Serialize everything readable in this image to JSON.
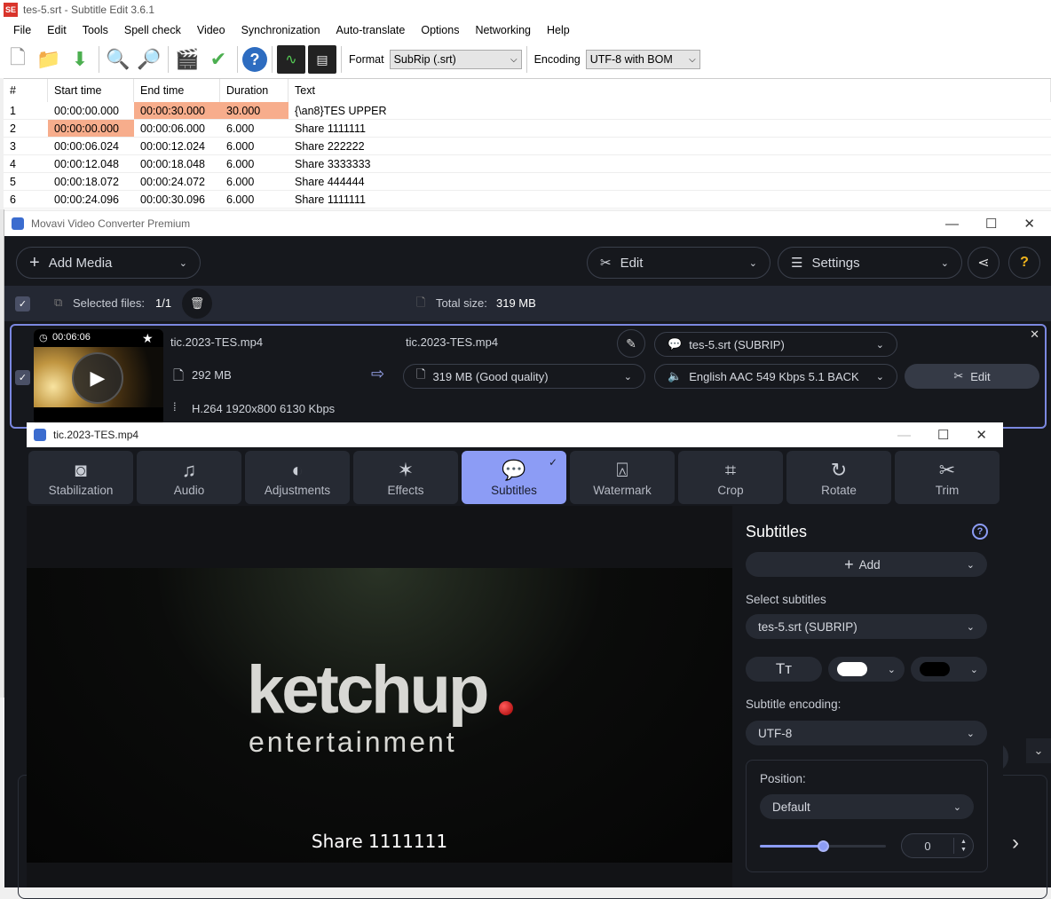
{
  "se": {
    "title": "tes-5.srt - Subtitle Edit 3.6.1",
    "logo": "SE",
    "menu": [
      "File",
      "Edit",
      "Tools",
      "Spell check",
      "Video",
      "Synchronization",
      "Auto-translate",
      "Options",
      "Networking",
      "Help"
    ],
    "format_label": "Format",
    "format_value": "SubRip (.srt)",
    "encoding_label": "Encoding",
    "encoding_value": "UTF-8 with BOM",
    "columns": [
      "#",
      "Start time",
      "End time",
      "Duration",
      "Text"
    ],
    "rows": [
      [
        "1",
        "00:00:00.000",
        "00:00:30.000",
        "30.000",
        "{\\an8}TES UPPER"
      ],
      [
        "2",
        "00:00:00.000",
        "00:00:06.000",
        "6.000",
        "Share 1111111"
      ],
      [
        "3",
        "00:00:06.024",
        "00:00:12.024",
        "6.000",
        "Share 222222"
      ],
      [
        "4",
        "00:00:12.048",
        "00:00:18.048",
        "6.000",
        "Share 3333333"
      ],
      [
        "5",
        "00:00:18.072",
        "00:00:24.072",
        "6.000",
        "Share 444444"
      ],
      [
        "6",
        "00:00:24.096",
        "00:00:30.096",
        "6.000",
        "Share 1111111"
      ]
    ]
  },
  "mv": {
    "title": "Movavi Video Converter Premium",
    "add_media": "Add Media",
    "edit": "Edit",
    "settings": "Settings",
    "selected_label": "Selected files:",
    "selected_value": "1/1",
    "total_label": "Total size:",
    "total_value": "319 MB",
    "item": {
      "duration": "00:06:06",
      "name": "tic.2023-TES.mp4",
      "size": "292 MB",
      "codec": "H.264 1920x800 6130 Kbps",
      "out_name": "tic.2023-TES.mp4",
      "out_size": "319 MB (Good quality)",
      "subtitle": "tes-5.srt (SUBRIP)",
      "audio": "English AAC 549 Kbps 5.1 BACK",
      "edit": "Edit"
    }
  },
  "child": {
    "title": "tic.2023-TES.mp4",
    "tabs": [
      "Stabilization",
      "Audio",
      "Adjustments",
      "Effects",
      "Subtitles",
      "Watermark",
      "Crop",
      "Rotate",
      "Trim"
    ],
    "video_logo_1": "ketchup",
    "video_logo_2": "entertainment",
    "subtitle_text": "Share 1111111",
    "panel": {
      "title": "Subtitles",
      "add": "Add",
      "select_label": "Select subtitles",
      "select_value": "tes-5.srt (SUBRIP)",
      "encoding_label": "Subtitle encoding:",
      "encoding_value": "UTF-8",
      "position_label": "Position:",
      "position_value": "Default",
      "position_number": "0",
      "slider_fraction": 0.5
    }
  },
  "colors": {
    "accent": "#8c9cf5",
    "highlight": "#f7ad8c",
    "dark": "#16181d"
  }
}
